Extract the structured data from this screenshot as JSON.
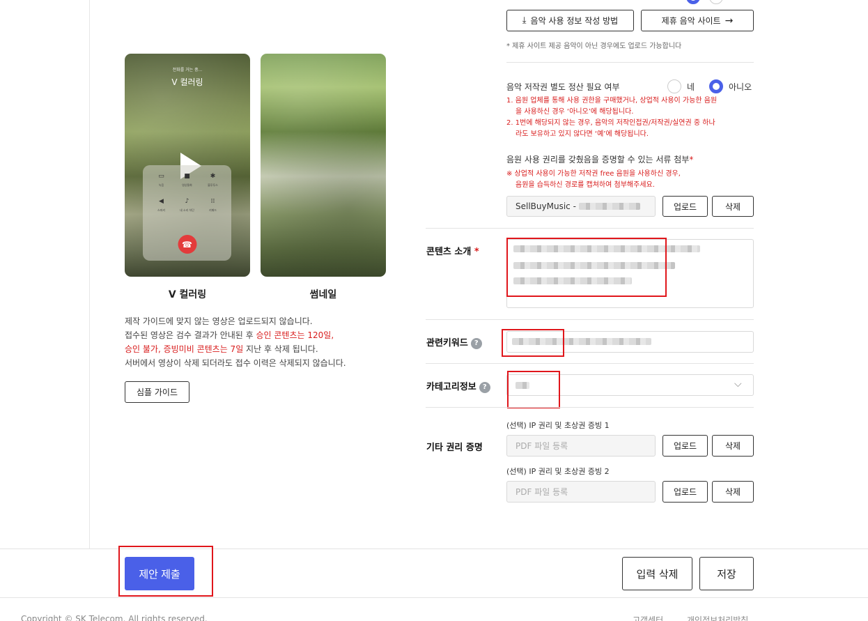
{
  "preview": {
    "phone1": {
      "subtitle": "전화를 거는 중...",
      "title": "V 컬러링",
      "caption": "V 컬러링",
      "call_buttons": [
        {
          "label": "녹음",
          "icon": "record-icon",
          "glyph": "▭"
        },
        {
          "label": "영상통화",
          "icon": "video-call-icon",
          "glyph": "■"
        },
        {
          "label": "블루투스",
          "icon": "bluetooth-icon",
          "glyph": "✱"
        },
        {
          "label": "스피커",
          "icon": "speaker-icon",
          "glyph": "◀"
        },
        {
          "label": "내 소리 차단",
          "icon": "mute-icon",
          "glyph": "♪"
        },
        {
          "label": "키패드",
          "icon": "keypad-icon",
          "glyph": "⁞⁞"
        }
      ]
    },
    "phone2": {
      "caption": "썸네일"
    },
    "notes": {
      "line1": "제작 가이드에 맞지 않는 영상은 업로드되지 않습니다.",
      "line2_a": "접수된 영상은 검수 결과가 안내된 후 ",
      "line2_b": "승인 콘텐츠는 120일,",
      "line3_a": "승인 불가, 증빙미비 콘텐츠는 7일",
      "line3_b": " 지난 후 삭제 됩니다.",
      "line4": "서버에서 영상이 삭제 되더라도 접수 이력은 삭제되지 않습니다."
    },
    "guide_button": "심플 가이드"
  },
  "music": {
    "how_to_button": "음악 사용 정보 작성 방법",
    "partner_button": "제휴 음악 사이트",
    "partner_note": "*  제휴 사이트 제공 음악이 아닌 경우에도 업로드 가능합니다",
    "copyright_question": "음악 저작권 별도 정산 필요 여부",
    "option_yes": "네",
    "option_no": "아니오",
    "selected": "아니오",
    "rule1_a": "1. 음원 업체를 통해 사용 권한을 구매했거나, 상업적 사용이 가능한 음원",
    "rule1_b": "을 사용하신 경우 ‘아니오’에 해당됩니다.",
    "rule2_a": "2. 1번에 해당되지 않는 경우, 음악의 저작인접권/저작권/실연권 중 하나",
    "rule2_b": "라도 보유하고 있지 않다면 ‘예’에 해당됩니다.",
    "proof_label": "음원 사용 권리를 갖췄음을 증명할 수 있는 서류 첨부",
    "proof_warn_a": "※ 상업적 사용이 가능한 저작권 free 음원을 사용하신 경우,",
    "proof_warn_b": "음원을 습득하신 경로를 캡쳐하여 첨부해주세요.",
    "file_value": "SellBuyMusic -",
    "upload": "업로드",
    "delete": "삭제"
  },
  "form": {
    "intro_label": "콘텐츠 소개",
    "keyword_label": "관련키워드",
    "category_label": "카테고리정보",
    "rights_label": "기타 권리 증명",
    "ip1_label": "(선택) IP 권리 및 초상권 증빙 1",
    "ip2_label": "(선택) IP 권리 및 초상권 증빙 2",
    "pdf_placeholder": "PDF 파일 등록",
    "upload": "업로드",
    "delete": "삭제",
    "help_glyph": "?",
    "required_mark": "*"
  },
  "actions": {
    "submit": "제안 제출",
    "reset": "입력 삭제",
    "save": "저장"
  },
  "footer": {
    "copyright": "Copyright © SK Telecom. All rights reserved.",
    "help_center": "고객센터",
    "privacy": "개인정보처리방침"
  },
  "colors": {
    "accent": "#4a60e8",
    "warning": "#d81b1b",
    "annotation": "#e0161b"
  }
}
